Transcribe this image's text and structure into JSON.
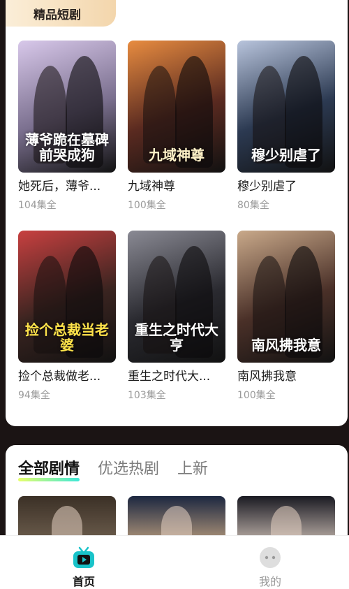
{
  "featured": {
    "tag": "精品短剧",
    "dramas": [
      {
        "title": "她死后，薄爷...",
        "count": "104集全",
        "poster_text": "薄爷跪在墓碑前哭成狗",
        "bg": "#7a6f8e",
        "accent": "#d8c8ea",
        "text_color": "#ffffff"
      },
      {
        "title": "九域神尊",
        "count": "100集全",
        "poster_text": "九域神尊",
        "bg": "#5a2a20",
        "accent": "#e88c40",
        "text_color": "#fff2c8"
      },
      {
        "title": "穆少别虐了",
        "count": "80集全",
        "poster_text": "穆少别虐了",
        "bg": "#2c3a52",
        "accent": "#b8c4dc",
        "text_color": "#ffffff"
      },
      {
        "title": "捡个总裁做老...",
        "count": "94集全",
        "poster_text": "捡个总裁当老婆",
        "bg": "#3a2420",
        "accent": "#c84040",
        "text_color": "#ffe34a"
      },
      {
        "title": "重生之时代大...",
        "count": "103集全",
        "poster_text": "重生之时代大亨",
        "bg": "#2a2a30",
        "accent": "#8a8a94",
        "text_color": "#ffffff"
      },
      {
        "title": "南风拂我意",
        "count": "100集全",
        "poster_text": "南风拂我意",
        "bg": "#4a3028",
        "accent": "#c9a98a",
        "text_color": "#ffffff"
      }
    ]
  },
  "tabs": [
    {
      "label": "全部剧情",
      "active": true
    },
    {
      "label": "优选热剧",
      "active": false
    },
    {
      "label": "上新",
      "active": false
    }
  ],
  "thumbs": [
    {
      "bg": "#3b3026",
      "accent": "#7a6a58"
    },
    {
      "bg": "#1c2740",
      "accent": "#d9b48a"
    },
    {
      "bg": "#1a1a22",
      "accent": "#e8d8cc"
    }
  ],
  "nav": {
    "home_label": "首页",
    "mine_label": "我的",
    "home_color": "#19c3c9"
  }
}
